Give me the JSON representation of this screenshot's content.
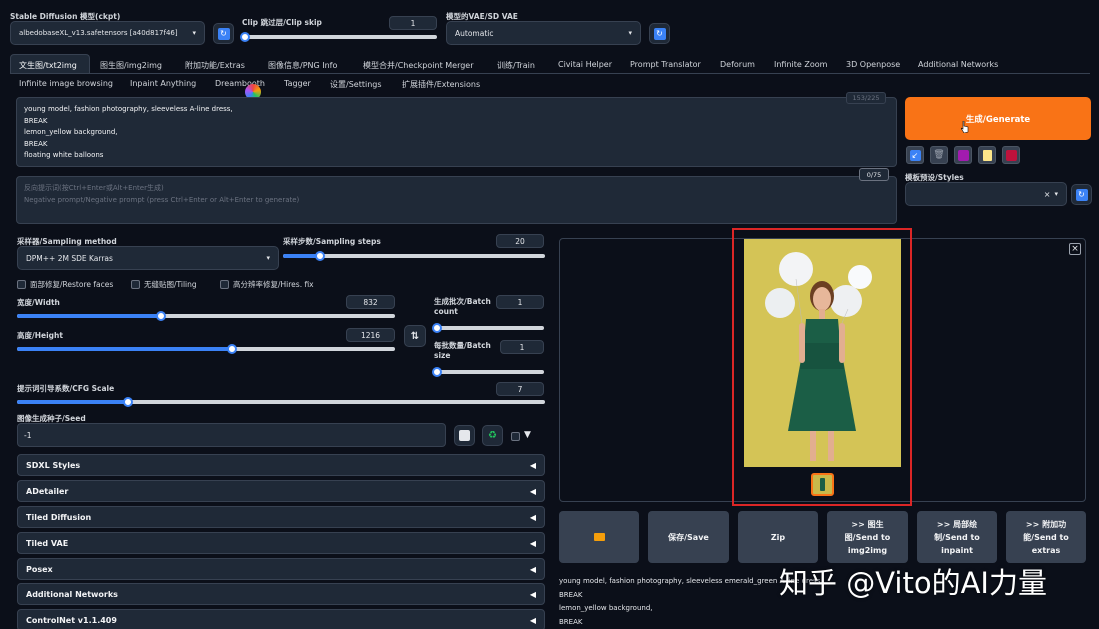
{
  "top": {
    "checkpoint": {
      "label": "Stable Diffusion 模型(ckpt)",
      "value": "albedobaseXL_v13.safetensors [a40d817f46]"
    },
    "clip_skip": {
      "label": "Clip 跳过层/Clip skip",
      "value": "1"
    },
    "vae": {
      "label": "模型的VAE/SD VAE",
      "value": "Automatic"
    }
  },
  "tabs_row1": [
    "文生图/txt2img",
    "图生图/img2img",
    "附加功能/Extras",
    "图像信息/PNG Info",
    "模型合并/Checkpoint Merger",
    "训练/Train",
    "Civitai Helper",
    "Prompt Translator",
    "Deforum",
    "Infinite Zoom",
    "3D Openpose",
    "Additional Networks"
  ],
  "tabs_row2": [
    "Infinite image browsing",
    "Inpaint Anything",
    "Dreambooth",
    "Tagger",
    "设置/Settings",
    "扩展插件/Extensions"
  ],
  "prompt": {
    "text": "young model, fashion photography, sleeveless A-line dress,\nBREAK\nlemon_yellow background,\nBREAK\nfloating white balloons",
    "token_count": "153/225"
  },
  "negative_prompt": {
    "placeholder_cn": "反向提示词(按Ctrl+Enter或Alt+Enter生成)",
    "placeholder_en": "Negative prompt/Negative prompt (press Ctrl+Enter or Alt+Enter to generate)",
    "token_count": "0/75"
  },
  "generate": {
    "label": "生成/Generate",
    "color": "#f97316"
  },
  "styles": {
    "label": "模板预设/Styles"
  },
  "sampling": {
    "method_label": "采样器/Sampling method",
    "method_value": "DPM++ 2M SDE Karras",
    "steps_label": "采样步数/Sampling steps",
    "steps_value": "20",
    "steps_fraction": 0.14
  },
  "checkboxes": [
    "面部修复/Restore faces",
    "无缝贴图/Tiling",
    "高分辨率修复/Hires. fix"
  ],
  "width": {
    "label": "宽度/Width",
    "value": "832",
    "fraction": 0.38
  },
  "height": {
    "label": "高度/Height",
    "value": "1216",
    "fraction": 0.57
  },
  "batch_count": {
    "label": "生成批次/Batch count",
    "value": "1",
    "fraction": 0.0
  },
  "batch_size": {
    "label": "每批数量/Batch size",
    "value": "1",
    "fraction": 0.0
  },
  "cfg": {
    "label": "提示词引导系数/CFG Scale",
    "value": "7",
    "fraction": 0.21
  },
  "seed": {
    "label": "图像生成种子/Seed",
    "value": "-1"
  },
  "accordions": [
    "SDXL Styles",
    "ADetailer",
    "Tiled Diffusion",
    "Tiled VAE",
    "Posex",
    "Additional Networks",
    "ControlNet v1.1.409"
  ],
  "output_buttons": [
    {
      "icon": "folder-icon",
      "label": ""
    },
    {
      "label": "保存/Save"
    },
    {
      "label": "Zip"
    },
    {
      "label": ">> 图生\n图/Send to\nimg2img"
    },
    {
      "label": ">> 局部绘\n制/Send to\ninpaint"
    },
    {
      "label": ">> 附加功\n能/Send to\nextras"
    }
  ],
  "output_info": "young model, fashion photography, sleeveless emerald_green A-line dress,\nBREAK\nlemon_yellow background,\nBREAK",
  "watermark": "知乎 @Vito的AI力量",
  "colors": {
    "accent": "#3b82f6",
    "highlight_border": "#dc2626",
    "image_bg": "#d9c95a",
    "dress": "#1b5e46"
  }
}
